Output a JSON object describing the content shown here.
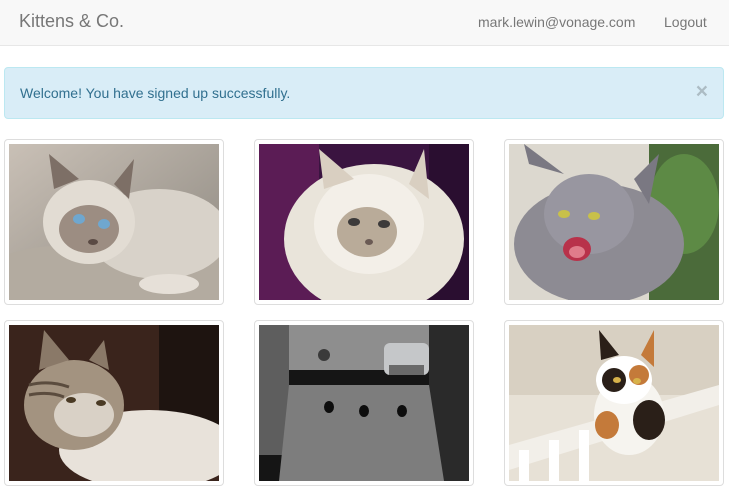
{
  "navbar": {
    "brand": "Kittens & Co.",
    "user_email": "mark.lewin@vonage.com",
    "logout_label": "Logout"
  },
  "alert": {
    "message": "Welcome! You have signed up successfully.",
    "close_symbol": "×",
    "color": "#d9edf7"
  },
  "gallery": {
    "images": [
      {
        "subject": "siamese-cat-photo"
      },
      {
        "subject": "fluffy-cream-cat-photo"
      },
      {
        "subject": "hissing-gray-cat-photo"
      },
      {
        "subject": "tabby-cat-lying-photo"
      },
      {
        "subject": "black-cats-in-street-photo"
      },
      {
        "subject": "calico-cat-on-railing-photo"
      }
    ]
  }
}
